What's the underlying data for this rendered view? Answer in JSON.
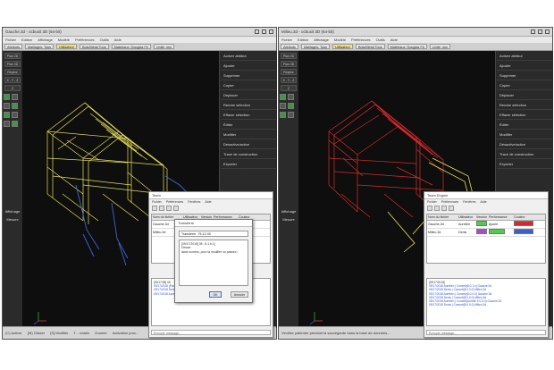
{
  "colors": {
    "accent_yellow": "#e8e05a",
    "frame_red": "#d92a2a",
    "blue_parts": "#3e67d4",
    "swatch_green": "#4dcc4d",
    "swatch_purple": "#a24ec9",
    "swatch_red": "#d02a2a",
    "swatch_blue": "#3d5fcc"
  },
  "left_window": {
    "title": "Gauche.3d - ocbuxit 3D (64-bit)",
    "menu": [
      "Fichier",
      "Edition",
      "Affichage",
      "Modèle",
      "Préférences",
      "Outils",
      "Aide"
    ],
    "toolbar": [
      "Attributs",
      "Maillages: Tous",
      "Utilisateur",
      "Bois/Métal Tous",
      "Matériaux: Douglas Fir",
      "Unité: mm",
      "Hôte: mm",
      "Eng"
    ],
    "left_buttons": [
      "Plan 2D",
      "Plan 3D",
      "Repère",
      "X - Y - Z",
      "Z"
    ],
    "left_labels": [
      "Affichage",
      "Mesure"
    ],
    "right_items": [
      "Activer attribut",
      "Ajouter",
      "Supprimer",
      "Copier",
      "Déplacer",
      "Rendre sélection",
      "Effacer sélection",
      "Éditer",
      "Modifier",
      "Désactive/active",
      "Trace de construction",
      "Exporter"
    ],
    "status": [
      "(C) Activer",
      "(M) Glisser",
      "[S] Modifier",
      "T... rotatio",
      "Zoomer",
      "Activation proc..."
    ]
  },
  "right_window": {
    "title": "Milieu.3d - ocbuxit 3D (64-bit)",
    "menu": [
      "Fichier",
      "Edition",
      "Affichage",
      "Modèle",
      "Préférences",
      "Outils",
      "Aide"
    ],
    "toolbar": [
      "Attributs",
      "Maillages: Tous",
      "Utilisateur",
      "Bois/Métal Tous",
      "Matériaux: Douglas Fir",
      "Unité: mm",
      "Hôte: mm",
      "Eng"
    ],
    "left_buttons": [
      "Plan 2D",
      "Plan 3D",
      "Repère",
      "X - Y - Z",
      "Z"
    ],
    "left_labels": [
      "Affichage",
      "Mesure"
    ],
    "right_items": [
      "Activer attribut",
      "Ajouter",
      "Supprimer",
      "Copier",
      "Déplacer",
      "Rendre sélection",
      "Effacer sélection",
      "Éditer",
      "Modifier",
      "Désactive/active",
      "Trace de construction",
      "Exporter"
    ],
    "status": [
      "Veuillez patienter pendant la sauvegarde dans la base de données..."
    ]
  },
  "team_left": {
    "title": "Team",
    "menu": [
      "Fichier",
      "Préférences",
      "Fenêtres",
      "Aide"
    ],
    "headers": [
      "Nom du fichier",
      "Utilisateur",
      "Version",
      "Performance",
      "Couleur"
    ],
    "rows": [
      {
        "file": "Gauche.3d",
        "user": "",
        "version": "",
        "perf": ""
      },
      {
        "file": "Milieu.3d",
        "user": "",
        "version": "",
        "perf": ""
      }
    ],
    "log": [
      "[09/17/08] 08",
      "09/17/2018 (Ravin) Commit : Gauche.3d",
      "09/17/2018 Denis ...",
      "09/17/2018 Aurelien ..."
    ],
    "message_placeholder": "Envoyer message..."
  },
  "transfer_dialog": {
    "title": "Transferts",
    "field_label": "Transferer",
    "field_value": "75-12-00",
    "message_lines": [
      "[09/17/2018] 08 : 8.1.6.1]",
      "Dessin",
      "dans numéro, pour la modifier ou passez /"
    ],
    "ok_label": "OK",
    "cancel_label": "Annuler"
  },
  "team_right": {
    "title": "Team Engine",
    "menu": [
      "Fichier",
      "Préférences",
      "Fenêtres",
      "Aide"
    ],
    "headers": [
      "Nom du fichier",
      "Utilisateur",
      "Version",
      "Performance",
      "Couleur"
    ],
    "rows": [
      {
        "file": "Gauche.3d",
        "user": "Aurelien",
        "version": "",
        "perf": "Ajouté"
      },
      {
        "file": "Milieu.3d",
        "user": "Denis",
        "version": "",
        "perf": ""
      }
    ],
    "log": [
      "[09/17/2018]",
      "09/17/2018 Aurelien | Commit(8.0.1.x) Gauche.3d",
      "09/17/2018 Denis | Commit(8.0.0.0) Milieu.3d",
      "09/17/2018 Aurelien | Commit(8.0.0.0) Gauche.3d",
      "09/17/2018 Denis | Commit(8.0.0.0) Milieu.3d",
      "09/17/2018 Aurelien | Commit(Aurelie 9.0.0.0) Gauche.3d",
      "09/17/2018 Denis | Commit(8.0.0.0) Milieu.3d"
    ],
    "message_placeholder": "Envoyer message..."
  }
}
